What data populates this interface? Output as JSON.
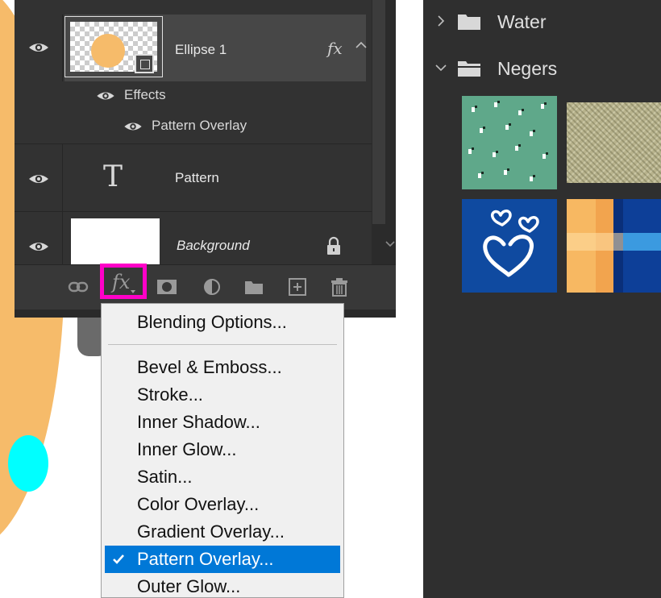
{
  "layers_panel": {
    "layers": [
      {
        "name": "Ellipse 1",
        "fx_badge": "fx"
      },
      {
        "name": "Pattern"
      },
      {
        "name": "Background"
      }
    ],
    "effects": {
      "label": "Effects",
      "items": [
        "Pattern Overlay"
      ]
    },
    "text_layer_glyph": "T",
    "bottom_bar": {
      "icons": [
        "link-icon",
        "fx-icon",
        "mask-icon",
        "adjustment-icon",
        "folder-icon",
        "new-layer-icon",
        "trash-icon"
      ],
      "fx_label": "fx",
      "highlight_color": "#ff00c8"
    }
  },
  "fx_menu": {
    "items": [
      {
        "label": "Blending Options..."
      },
      {
        "label": "Bevel & Emboss..."
      },
      {
        "label": "Stroke..."
      },
      {
        "label": "Inner Shadow..."
      },
      {
        "label": "Inner Glow..."
      },
      {
        "label": "Satin..."
      },
      {
        "label": "Color Overlay..."
      },
      {
        "label": "Gradient Overlay..."
      },
      {
        "label": "Pattern Overlay...",
        "checked": true,
        "selected": true
      },
      {
        "label": "Outer Glow..."
      }
    ],
    "selected_color": "#0078d7"
  },
  "patterns_panel": {
    "folders": [
      {
        "label": "Water",
        "expanded": false
      },
      {
        "label": "Negers",
        "expanded": true
      }
    ],
    "swatches": [
      "green-dots-pattern",
      "burlap-pattern",
      "blue-hearts-pattern",
      "plaid-pattern"
    ]
  },
  "colors": {
    "panel_bg": "#323232",
    "selected_layer": "#474747",
    "accent_orange": "#f6bb6a"
  }
}
